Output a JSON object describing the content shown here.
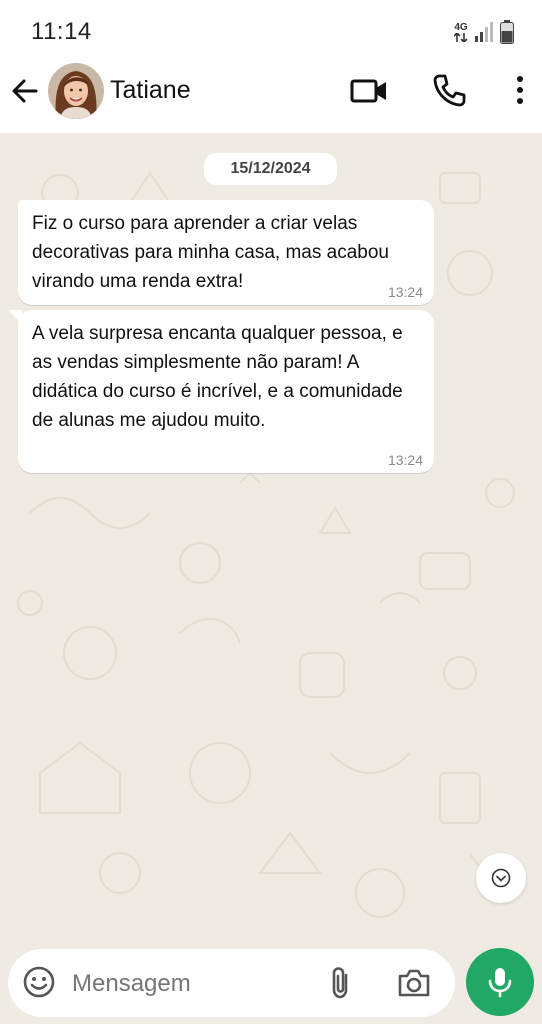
{
  "status_bar": {
    "time": "11:14",
    "network": "4G",
    "icons": [
      "network-arrows-icon",
      "signal-icon",
      "battery-icon"
    ]
  },
  "header": {
    "contact_name": "Tatiane",
    "icons": [
      "back-arrow-icon",
      "avatar",
      "video-call-icon",
      "phone-icon",
      "more-options-icon"
    ]
  },
  "chat": {
    "date_chip": "15/12/2024",
    "messages": [
      {
        "text": "Fiz o curso para aprender a criar velas decorativas para minha casa, mas acabou virando uma renda extra!",
        "time": "13:24"
      },
      {
        "text": "A vela surpresa encanta qualquer pessoa, e as vendas simplesmente não param! A didática do curso é incrível, e a comunidade de alunas me ajudou muito.",
        "time": "13:24"
      }
    ]
  },
  "composer": {
    "placeholder": "Mensagem",
    "icons": [
      "emoji-icon",
      "attach-icon",
      "camera-icon",
      "mic-icon",
      "scroll-down-icon"
    ]
  },
  "colors": {
    "accent_green": "#21a865",
    "chat_background": "#efeae2",
    "bubble": "#ffffff",
    "timestamp": "#8a8a8a"
  }
}
